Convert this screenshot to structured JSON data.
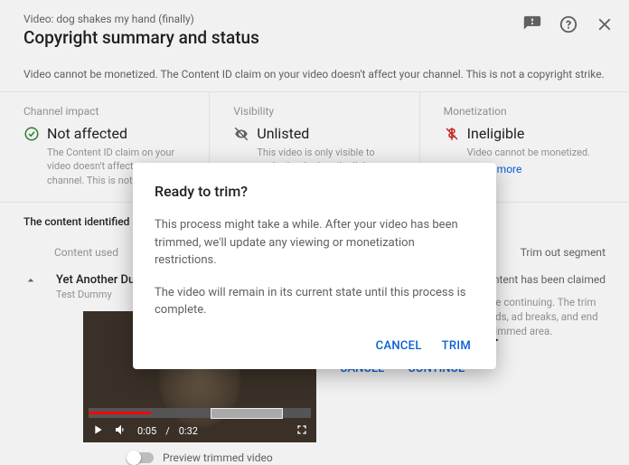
{
  "header": {
    "video_line": "Video: dog shakes my hand (finally)",
    "title": "Copyright summary and status"
  },
  "banner": "Video cannot be monetized. The Content ID claim on your video doesn't affect your channel. This is not a copyright strike.",
  "impact": {
    "label": "Channel impact",
    "value": "Not affected",
    "desc": "The Content ID claim on your video doesn't affect your channel. This is not …"
  },
  "visibility": {
    "label": "Visibility",
    "value": "Unlisted",
    "desc": "This video is only visible to anybody who has the link."
  },
  "monetization": {
    "label": "Monetization",
    "value": "Ineligible",
    "desc": "Video cannot be monetized.",
    "learn_more": "Learn more"
  },
  "section_label": "The content identified in your",
  "tabs": {
    "content_used": "Content used",
    "trim_out": "Trim out segment"
  },
  "claim": {
    "title": "Yet Another Dummy",
    "artist": "Test Dummy"
  },
  "player": {
    "current": "0:05",
    "duration": "0:32"
  },
  "preview_toggle_label": "Preview trimmed video",
  "right": {
    "claimed": "content has been claimed",
    "warning": "Double-check your video before continuing. The trim will remove things like info cards, ad breaks, and end screens that exist within the trimmed area.",
    "cancel": "CANCEL",
    "continue": "CONTINUE"
  },
  "modal": {
    "title": "Ready to trim?",
    "p1": "This process might take a while. After your video has been trimmed, we'll update any viewing or monetization restrictions.",
    "p2": "The video will remain in its current state until this process is complete.",
    "cancel": "CANCEL",
    "trim": "TRIM"
  }
}
